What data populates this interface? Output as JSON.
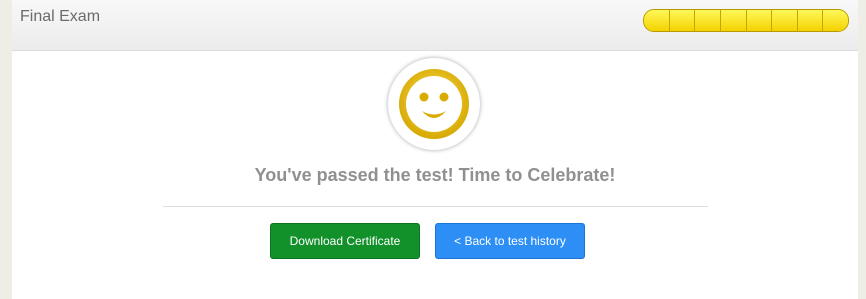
{
  "header": {
    "title": "Final Exam",
    "progress": {
      "completed_segments": 8,
      "total_segments": 8,
      "fill_color": "#f4d200"
    }
  },
  "result": {
    "icon": "smiley-face-icon",
    "icon_color": "#e6b800",
    "message": "You've passed the test! Time to Celebrate!"
  },
  "actions": {
    "download_label": "Download Certificate",
    "download_color": "#12902a",
    "back_label": "< Back to test history",
    "back_color": "#2d8ff5"
  }
}
